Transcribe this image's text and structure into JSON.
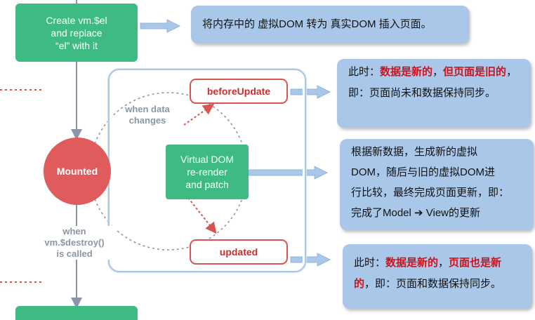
{
  "create_el": {
    "line1": "Create vm.$el",
    "line2": "and replace",
    "line3": "“el” with it"
  },
  "note_top": "将内存中的 虚拟DOM 转为 真实DOM 插入页面。",
  "before_update": "beforeUpdate",
  "note_before": {
    "p1": "此时：",
    "p2": "数据是新的",
    "p3": "，",
    "p4": "但页面是旧的",
    "p5": "，即：页面尚未和数据保持同步。"
  },
  "when_data": {
    "line1": "when data",
    "line2": "changes"
  },
  "mounted": "Mounted",
  "vdom": {
    "line1": "Virtual DOM",
    "line2": "re-render",
    "line3": "and patch"
  },
  "note_vdom": {
    "line1": "根据新数据，生成新的虚拟",
    "line2": "DOM，随后与旧的虚拟DOM进",
    "line3": "行比较，最终完成页面更新，即：",
    "line4": "完成了Model ➔ View的更新"
  },
  "when_destroy": {
    "line1": "when",
    "line2": "vm.$destroy()",
    "line3": "is called"
  },
  "updated": "updated",
  "note_updated": {
    "p1": "此时：",
    "p2": "数据是新的",
    "p3": "，",
    "p4": "页面也是新的",
    "p5": "，即：页面和数据保持同步。"
  },
  "colors": {
    "green": "#3dbb82",
    "red": "#d9534f",
    "note_blue": "#a9c7e8",
    "arrow_blue": "#8fb4dc",
    "circle_red": "#e05b5b"
  }
}
